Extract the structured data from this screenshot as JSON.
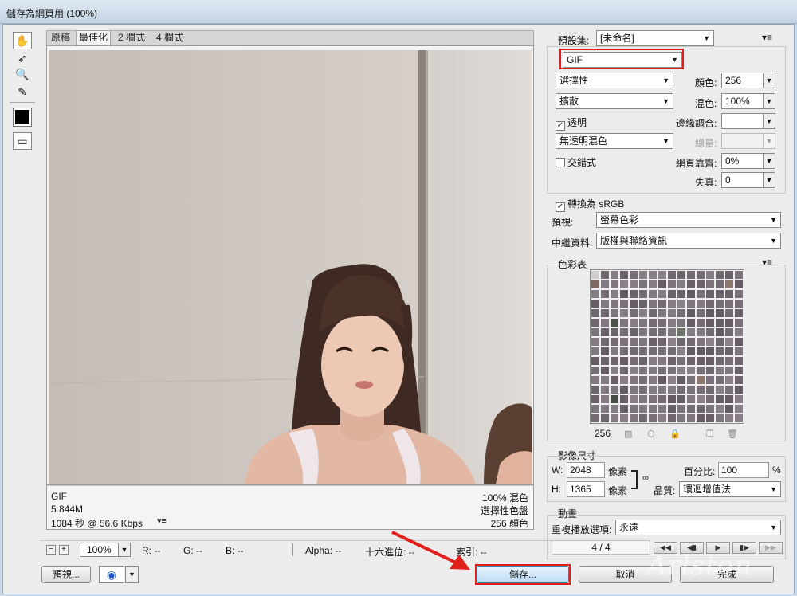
{
  "window": {
    "title": "儲存為網頁用 (100%)"
  },
  "tabs": [
    "原稿",
    "最佳化",
    "2 欄式",
    "4 欄式"
  ],
  "tabs_selected": "最佳化",
  "image_info": {
    "format": "GIF",
    "size": "5.844M",
    "time": "1084 秒 @ 56.6 Kbps",
    "dither": "100% 混色",
    "palette": "選擇性色盤",
    "colors": "256 顏色"
  },
  "bottom_bar": {
    "zoom": "100%",
    "r": "R: --",
    "g": "G: --",
    "b": "B: --",
    "alpha": "Alpha: --",
    "hex": "十六進位: --",
    "index": "索引: --",
    "preview_button": "預視...",
    "save_button": "儲存...",
    "cancel_button": "取消",
    "done_button": "完成",
    "watermark": "Arlston"
  },
  "settings": {
    "preset_label": "預設集:",
    "preset_value": "[未命名]",
    "format": "GIF",
    "reduction": "選擇性",
    "dither_algo": "擴散",
    "transparency_label": "透明",
    "transparency_checked": true,
    "matte_dither": "無透明混色",
    "interlaced_label": "交錯式",
    "interlaced_checked": false,
    "colors_label": "顏色:",
    "colors_value": "256",
    "dither_label": "混色:",
    "dither_value": "100%",
    "matte_label": "邊緣調合:",
    "matte_value": "",
    "amount_label": "總量:",
    "amount_value": "",
    "websnap_label": "網頁靠齊:",
    "websnap_value": "0%",
    "lossy_label": "失真:",
    "lossy_value": "0",
    "srgb_label": "轉換為 sRGB",
    "srgb_checked": true,
    "preview_label": "預視:",
    "preview_value": "螢幕色彩",
    "metadata_label": "中繼資料:",
    "metadata_value": "版權與聯絡資訊"
  },
  "color_table": {
    "header": "色彩表",
    "count": "256"
  },
  "image_size": {
    "header": "影像尺寸",
    "w_label": "W:",
    "w_value": "2048",
    "h_label": "H:",
    "h_value": "1365",
    "unit": "像素",
    "percent_label": "百分比:",
    "percent_value": "100",
    "percent_unit": "%",
    "quality_label": "品質:",
    "quality_value": "環迴增值法"
  },
  "animation": {
    "header": "動畫",
    "loop_label": "重複播放選項:",
    "loop_value": "永遠",
    "frame": "4 / 4"
  },
  "colors": {
    "accent_red": "#e0201b",
    "swatch_black": "#000000"
  }
}
